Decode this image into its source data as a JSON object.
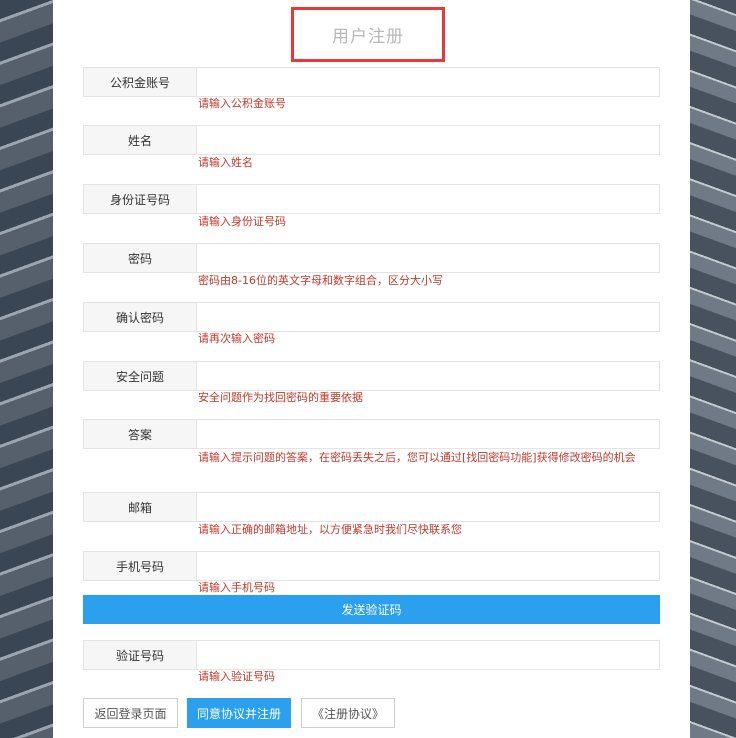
{
  "title": "用户注册",
  "fields": [
    {
      "label": "公积金账号",
      "value": "",
      "hint": "请输入公积金账号"
    },
    {
      "label": "姓名",
      "value": "",
      "hint": "请输入姓名"
    },
    {
      "label": "身份证号码",
      "value": "",
      "hint": "请输入身份证号码"
    },
    {
      "label": "密码",
      "value": "",
      "hint": "密码由8-16位的英文字母和数字组合，区分大小写"
    },
    {
      "label": "确认密码",
      "value": "",
      "hint": "请再次输入密码"
    },
    {
      "label": "安全问题",
      "value": "",
      "hint": "安全问题作为找回密码的重要依据"
    },
    {
      "label": "答案",
      "value": "",
      "hint": "请输入提示问题的答案，在密码丢失之后，您可以通过[找回密码功能]获得修改密码的机会"
    },
    {
      "label": "邮箱",
      "value": "",
      "hint": "请输入正确的邮箱地址，以方便紧急时我们尽快联系您"
    },
    {
      "label": "手机号码",
      "value": "",
      "hint": "请输入手机号码"
    },
    {
      "label": "验证号码",
      "value": "",
      "hint": "请输入验证号码"
    }
  ],
  "send_code_button": "发送验证码",
  "buttons": {
    "back": "返回登录页面",
    "agree": "同意协议并注册",
    "terms": "《注册协议》"
  },
  "colors": {
    "accent": "#2aa0ee",
    "hint": "#c0392b",
    "title_border": "#e5393d"
  }
}
